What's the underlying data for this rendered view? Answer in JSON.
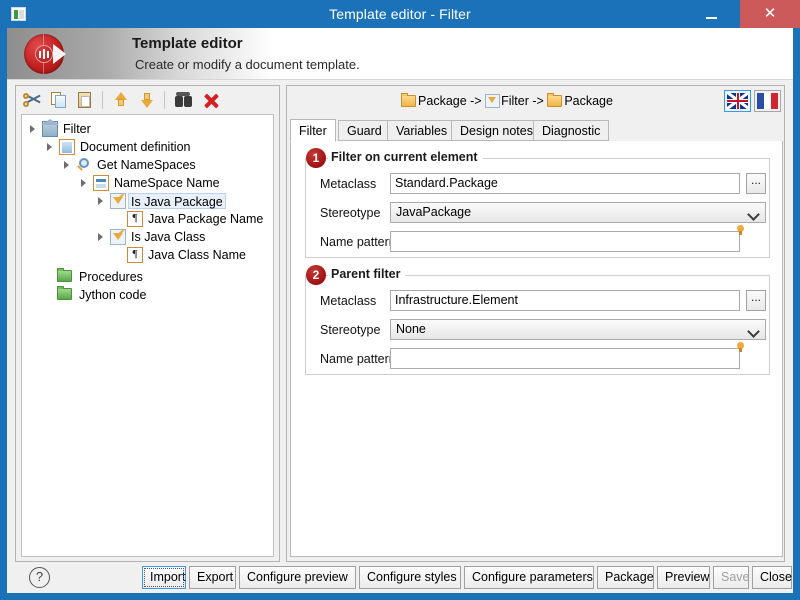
{
  "window": {
    "title": "Template editor - Filter",
    "icon": "app-icon",
    "controls": {
      "minimize": "–",
      "maximize": "□",
      "close": "✕"
    }
  },
  "banner": {
    "title": "Template editor",
    "subtitle": "Create or modify a document template."
  },
  "tree_toolbar": {
    "buttons": [
      {
        "name": "cut",
        "icon": "scissors-icon"
      },
      {
        "name": "copy",
        "icon": "copy-icon"
      },
      {
        "name": "paste",
        "icon": "paste-icon"
      },
      {
        "name": "move-up",
        "icon": "arrow-up-icon"
      },
      {
        "name": "move-down",
        "icon": "arrow-down-icon"
      },
      {
        "name": "find",
        "icon": "binoculars-icon"
      },
      {
        "name": "delete",
        "icon": "red-x-icon"
      }
    ]
  },
  "tree": {
    "nodes": [
      {
        "label": "Filter",
        "depth": 0,
        "icon": "house-icon",
        "expander": true,
        "selected": false
      },
      {
        "label": "Document definition",
        "depth": 1,
        "icon": "document-icon",
        "expander": true,
        "selected": false
      },
      {
        "label": "Get NameSpaces",
        "depth": 2,
        "icon": "magnifier-icon",
        "expander": true,
        "selected": false
      },
      {
        "label": "NameSpace Name",
        "depth": 3,
        "icon": "page-icon",
        "expander": true,
        "selected": false
      },
      {
        "label": "Is Java Package",
        "depth": 4,
        "icon": "filter-icon",
        "expander": true,
        "selected": true
      },
      {
        "label": "Java Package Name",
        "depth": 5,
        "icon": "paragraph-icon",
        "expander": false,
        "selected": false
      },
      {
        "label": "Is Java Class",
        "depth": 4,
        "icon": "filter-icon",
        "expander": true,
        "selected": false
      },
      {
        "label": "Java Class Name",
        "depth": 5,
        "icon": "paragraph-icon",
        "expander": false,
        "selected": false
      },
      {
        "label": "Procedures",
        "depth": 1,
        "icon": "folder-green-icon",
        "expander": false,
        "selected": false
      },
      {
        "label": "Jython code",
        "depth": 1,
        "icon": "folder-green-icon",
        "expander": false,
        "selected": false
      }
    ]
  },
  "breadcrumb": {
    "part1": "Package ->",
    "part2": "Filter ->",
    "part3": "Package"
  },
  "language": {
    "english": "en-flag-icon",
    "french": "fr-flag-icon"
  },
  "tabs": [
    {
      "label": "Filter",
      "active": true
    },
    {
      "label": "Guard",
      "active": false
    },
    {
      "label": "Variables",
      "active": false
    },
    {
      "label": "Design notes",
      "active": false
    },
    {
      "label": "Diagnostic",
      "active": false
    }
  ],
  "groups": [
    {
      "badge": "1",
      "title": "Filter on current element",
      "metaclass_label": "Metaclass",
      "metaclass_value": "Standard.Package",
      "metaclass_browse": "...",
      "stereotype_label": "Stereotype",
      "stereotype_value": "JavaPackage",
      "namepattern_label": "Name pattern",
      "namepattern_value": "",
      "namepattern_placeholder": ""
    },
    {
      "badge": "2",
      "title": "Parent filter",
      "metaclass_label": "Metaclass",
      "metaclass_value": "Infrastructure.Element",
      "metaclass_browse": "...",
      "stereotype_label": "Stereotype",
      "stereotype_value": "None",
      "namepattern_label": "Name pattern",
      "namepattern_value": "",
      "namepattern_placeholder": ""
    }
  ],
  "bottom_bar": {
    "help": "?",
    "buttons": [
      {
        "label": "Import",
        "focused": true,
        "disabled": false
      },
      {
        "label": "Export",
        "focused": false,
        "disabled": false
      },
      {
        "label": "Configure preview",
        "focused": false,
        "disabled": false
      },
      {
        "label": "Configure styles",
        "focused": false,
        "disabled": false
      },
      {
        "label": "Configure parameters",
        "focused": false,
        "disabled": false
      },
      {
        "label": "Package",
        "focused": false,
        "disabled": false
      },
      {
        "label": "Preview",
        "focused": false,
        "disabled": false
      },
      {
        "label": "Save",
        "focused": false,
        "disabled": true
      },
      {
        "label": "Close",
        "focused": false,
        "disabled": false
      }
    ]
  },
  "colors": {
    "window_frame": "#1b72b8",
    "close_button": "#cc5a5a",
    "badge_red": "#9e1212",
    "accent_blue": "#3d9ae0",
    "panel_bg": "#f0f0f0"
  }
}
